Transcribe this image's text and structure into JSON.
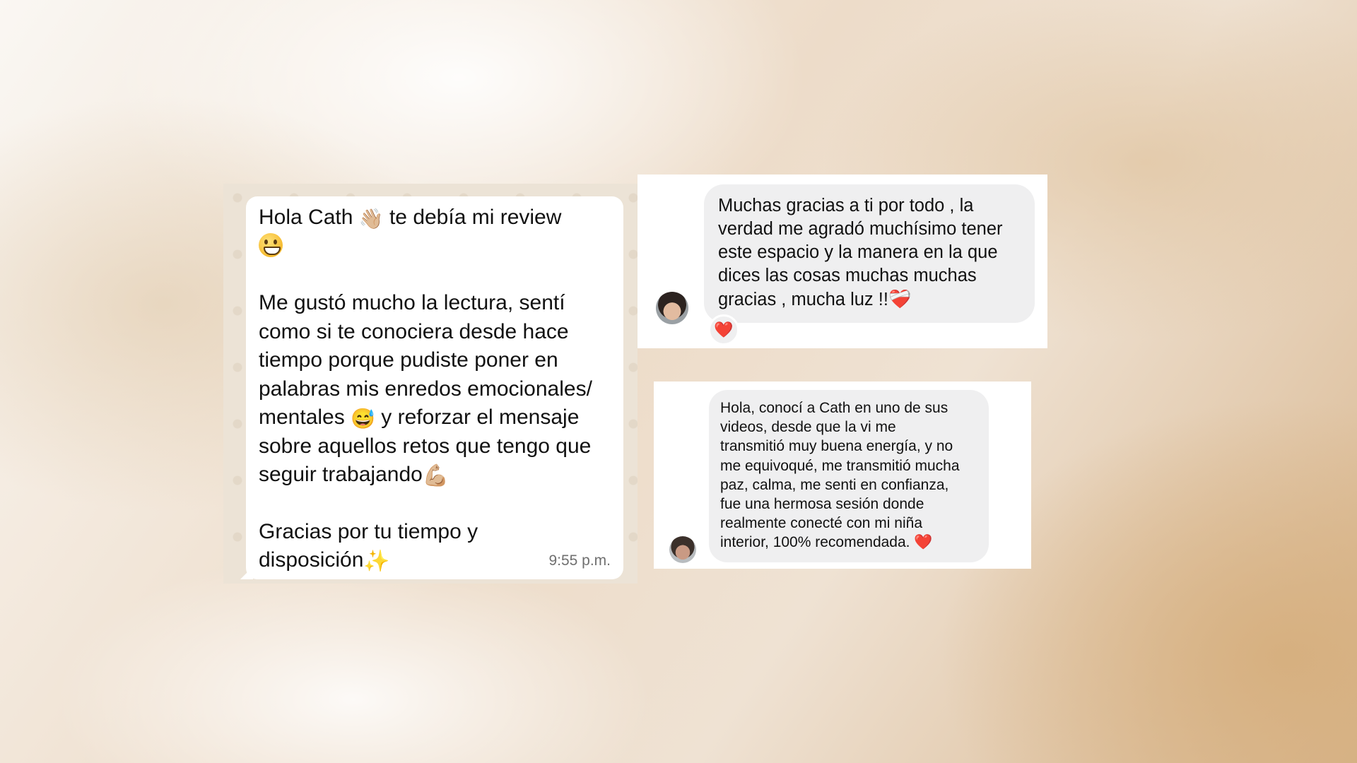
{
  "whatsapp": {
    "line1_text": "Hola Cath ",
    "line1_wave_emoji": "👋🏼",
    "line1_text2": " te debía mi review",
    "line2_grin_emoji": "grinning-face",
    "para2_text": "Me gustó mucho la lectura, sentí\ncomo si te conociera desde hace\ntiempo porque pudiste poner en\npalabras mis enredos emocionales/\nmentales ",
    "para2_sweat_emoji": "😅",
    "para2_text2": " y reforzar el mensaje\nsobre aquellos retos que tengo que\nseguir trabajando",
    "para2_muscle_emoji": "💪🏼",
    "para3_text": "Gracias por tu tiempo y\ndisposición",
    "para3_sparkle_emoji": "✨",
    "time": "9:55 p.m."
  },
  "instagram_message_1": {
    "text": "Muchas gracias a ti por todo , la\nverdad me agradó muchísimo tener\neste espacio y la manera en la que\ndices las cosas muchas muchas\ngracias , mucha luz !!",
    "end_emoji": "❤️‍🩹",
    "reaction_emoji": "❤️",
    "avatar_icon": "user-avatar-icon"
  },
  "instagram_message_2": {
    "text": "Hola, conocí a Cath en uno de sus\nvideos, desde que la vi me\ntransmitió muy buena energía, y no\nme equivoqué, me transmitió mucha\npaz, calma, me senti en confianza,\nfue una hermosa sesión donde\nrealmente conecté con mi niña\ninterior, 100% recomendada. ",
    "end_emoji": "❤️",
    "avatar_icon": "user-avatar-icon"
  },
  "colors": {
    "whatsapp_bubble": "#ffffff",
    "whatsapp_wallpaper": "#ece3d6",
    "instagram_bubble": "#efeff0",
    "heart_red": "#e4202c"
  }
}
